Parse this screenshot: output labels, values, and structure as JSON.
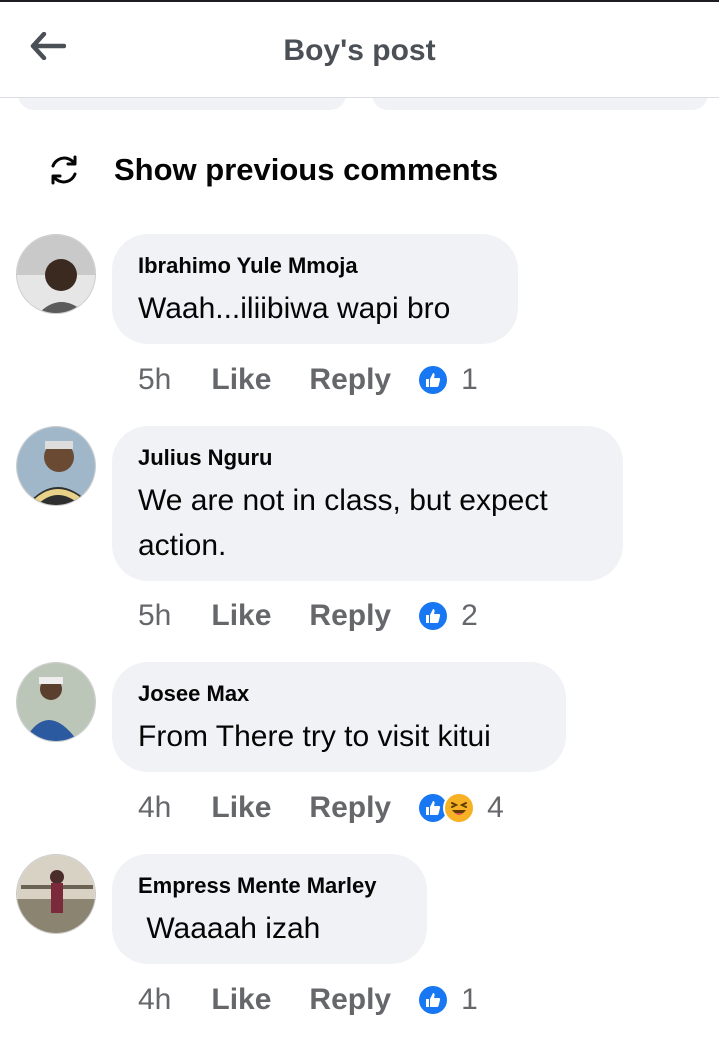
{
  "header": {
    "title": "Boy's post"
  },
  "show_previous": {
    "label": "Show previous comments"
  },
  "comments": [
    {
      "author": "Ibrahimo Yule Mmoja",
      "text": "Waah...iliibiwa wapi bro",
      "time": "5h",
      "like": "Like",
      "reply": "Reply",
      "reactions": [
        "like"
      ],
      "reaction_count": "1"
    },
    {
      "author": "Julius Nguru",
      "text": "We are not in class, but expect action.",
      "time": "5h",
      "like": "Like",
      "reply": "Reply",
      "reactions": [
        "like"
      ],
      "reaction_count": "2"
    },
    {
      "author": "Josee Max",
      "text": "From There try to visit kitui",
      "time": "4h",
      "like": "Like",
      "reply": "Reply",
      "reactions": [
        "like",
        "haha"
      ],
      "reaction_count": "4"
    },
    {
      "author": "Empress Mente Marley",
      "text": " Waaaah izah",
      "time": "4h",
      "like": "Like",
      "reply": "Reply",
      "reactions": [
        "like"
      ],
      "reaction_count": "1"
    }
  ],
  "colors": {
    "bubble": "#f0f2f5",
    "like_blue": "#1877f2",
    "meta_gray": "#65676b"
  }
}
